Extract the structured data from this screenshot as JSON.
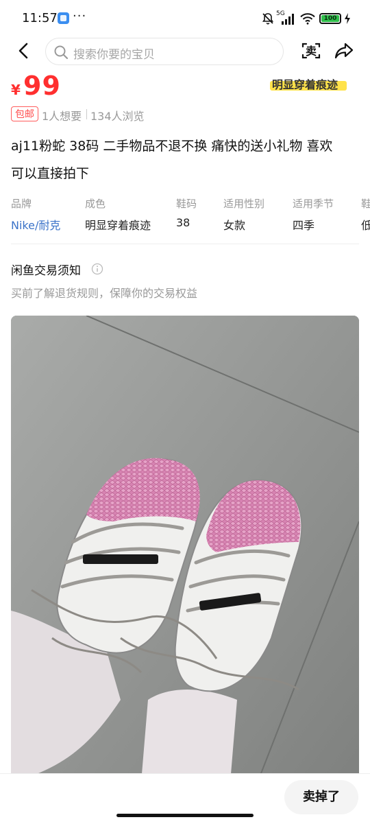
{
  "status_bar": {
    "time": "11:57",
    "more": "···",
    "network": "5G",
    "battery": "100"
  },
  "nav": {
    "search_placeholder": "搜索你要的宝贝",
    "sell_label": "卖"
  },
  "product": {
    "currency": "¥",
    "price": "99",
    "condition_tag": "明显穿着痕迹",
    "free_shipping": "包邮",
    "want_count": "1人想要",
    "view_count": "134人浏览",
    "title_line1": "aj11粉蛇 38码 二手物品不退不换 痛快的送小礼物 喜欢",
    "title_line2": "可以直接拍下"
  },
  "attributes": [
    {
      "label": "品牌",
      "value": "Nike/耐克"
    },
    {
      "label": "成色",
      "value": "明显穿着痕迹"
    },
    {
      "label": "鞋码",
      "value": "38"
    },
    {
      "label": "适用性别",
      "value": "女款"
    },
    {
      "label": "适用季节",
      "value": "四季"
    },
    {
      "label": "鞋",
      "value": "低"
    }
  ],
  "notice": {
    "title": "闲鱼交易须知",
    "subtitle": "买前了解退货规则，保障你的交易权益"
  },
  "photo": {
    "description_icon": "sneaker-photo"
  },
  "bottom": {
    "sold_button": "卖掉了"
  },
  "colors": {
    "price": "#ff2f2f",
    "link": "#3a72c8",
    "highlight": "#ffe24a",
    "battery": "#2fbf4a"
  }
}
